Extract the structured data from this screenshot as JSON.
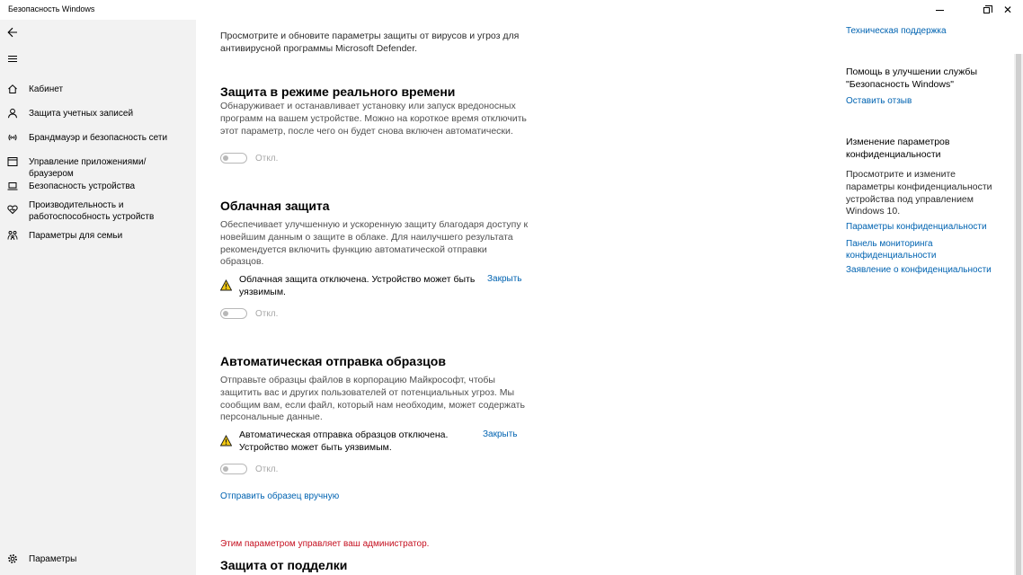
{
  "window": {
    "title": "Безопасность Windows",
    "controls": {
      "minimize": "–",
      "maximize": "□",
      "close": "✕"
    }
  },
  "sidebar": {
    "back_icon": "back-arrow-icon",
    "menu_icon": "hamburger-icon",
    "items": [
      {
        "label": "Кабинет",
        "icon": "home-icon"
      },
      {
        "label": "Защита учетных записей",
        "icon": "person-icon"
      },
      {
        "label": "Брандмауэр и безопасность сети",
        "icon": "wifi-icon"
      },
      {
        "label": "Управление приложениями/браузером",
        "icon": "app-browser-icon"
      },
      {
        "label": "Безопасность устройства",
        "icon": "laptop-icon"
      },
      {
        "label": "Производительность и работоспособность устройств",
        "icon": "heart-icon"
      },
      {
        "label": "Параметры для семьи",
        "icon": "family-icon"
      }
    ],
    "settings": {
      "label": "Параметры",
      "icon": "gear-icon"
    }
  },
  "main": {
    "intro": "Просмотрите и обновите параметры защиты от вирусов и угроз для антивирусной программы Microsoft Defender.",
    "realtime": {
      "title": "Защита в режиме реального времени",
      "description": "Обнаруживает и останавливает установку или запуск вредоносных программ на вашем устройстве. Можно на короткое время отключить этот параметр, после чего он будет снова включен автоматически.",
      "toggle_label": "Откл.",
      "toggle_on": false
    },
    "cloud": {
      "title": "Облачная защита",
      "description": "Обеспечивает улучшенную и ускоренную защиту благодаря доступу к новейшим данным о защите в облаке. Для наилучшего результата рекомендуется включить функцию автоматической отправки образцов.",
      "warning": "Облачная защита отключена. Устройство может быть уязвимым.",
      "dismiss": "Закрыть",
      "toggle_label": "Откл.",
      "toggle_on": false
    },
    "samples": {
      "title": "Автоматическая отправка образцов",
      "description": "Отправьте образцы файлов в корпорацию Майкрософт, чтобы защитить вас и других пользователей от потенциальных угроз. Мы сообщим вам, если файл, который нам необходим, может содержать персональные данные.",
      "warning": "Автоматическая отправка образцов отключена. Устройство может быть уязвимым.",
      "dismiss": "Закрыть",
      "toggle_label": "Откл.",
      "toggle_on": false,
      "manual_link": "Отправить образец вручную"
    },
    "admin_note": "Этим параметром управляет ваш администратор.",
    "tamper_title": "Защита от подделки"
  },
  "aside": {
    "support_link": "Техническая поддержка",
    "feedback_heading": "Помощь в улучшении службы \"Безопасность Windows\"",
    "feedback_link": "Оставить отзыв",
    "privacy_heading": "Изменение параметров конфиденциальности",
    "privacy_text": "Просмотрите и измените параметры конфиденциальности устройства под управлением Windows 10.",
    "privacy_links": [
      "Параметры конфиденциальности",
      "Панель мониторинга конфиденциальности",
      "Заявление о конфиденциальности"
    ]
  },
  "colors": {
    "sidebar_bg": "#f2f2f2",
    "link": "#0063b1",
    "admin_red": "#c50f1f",
    "warning_yellow": "#f2c811"
  }
}
